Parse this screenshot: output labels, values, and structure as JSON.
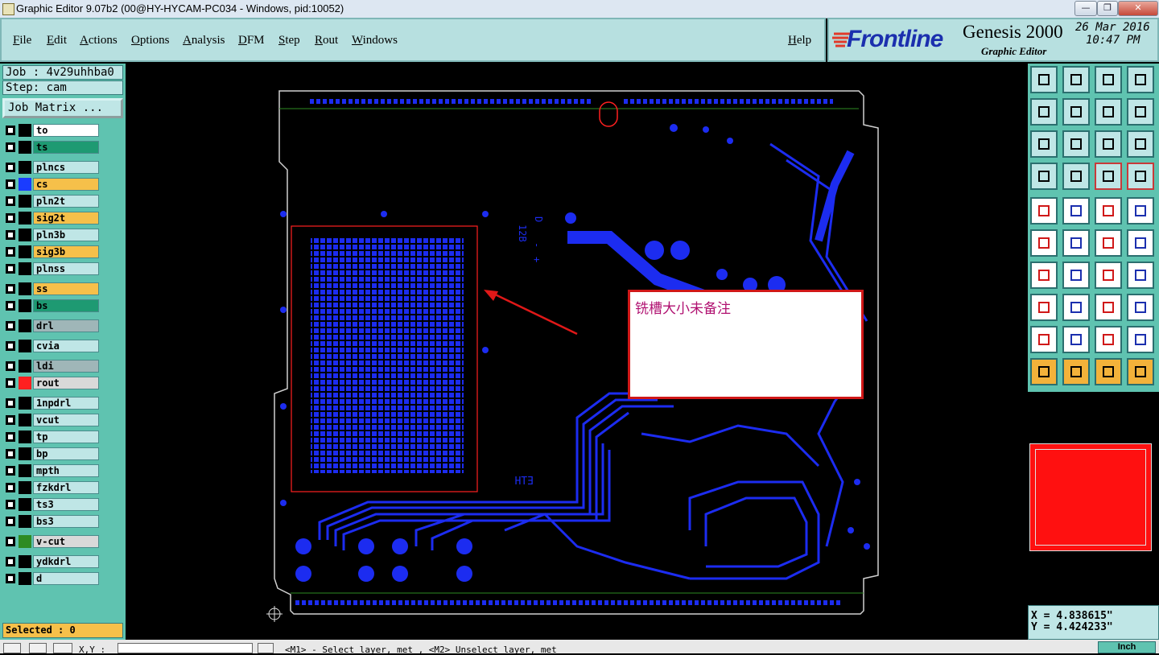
{
  "window": {
    "title": "Graphic Editor 9.07b2 (00@HY-HYCAM-PC034 - Windows, pid:10052)",
    "controls": [
      "—",
      "❐",
      "✕"
    ]
  },
  "menu": {
    "items": [
      "File",
      "Edit",
      "Actions",
      "Options",
      "Analysis",
      "DFM",
      "Step",
      "Rout",
      "Windows"
    ],
    "help": "Help"
  },
  "brand": {
    "logo": "Frontline",
    "product": "Genesis 2000",
    "subtitle": "Graphic Editor",
    "date": "26 Mar 2016",
    "time": "10:47 PM"
  },
  "job": {
    "job_label": "Job : 4v29uhhba0",
    "step_label": "Step: cam",
    "matrix_button": "Job Matrix ..."
  },
  "layers": [
    {
      "name": "to",
      "bg": "#ffffff",
      "swatch": "#000000"
    },
    {
      "name": "ts",
      "bg": "#1e9a72",
      "swatch": "#000000"
    },
    {
      "name": "plncs",
      "bg": "#bfe6e6",
      "swatch": "#000000"
    },
    {
      "name": "cs",
      "bg": "#f6c04a",
      "swatch": "#1a3cff"
    },
    {
      "name": "pln2t",
      "bg": "#bfe6e6",
      "swatch": "#000000"
    },
    {
      "name": "sig2t",
      "bg": "#f6c04a",
      "swatch": "#000000"
    },
    {
      "name": "pln3b",
      "bg": "#bfe6e6",
      "swatch": "#000000"
    },
    {
      "name": "sig3b",
      "bg": "#f6c04a",
      "swatch": "#000000"
    },
    {
      "name": "plnss",
      "bg": "#bfe6e6",
      "swatch": "#000000"
    },
    {
      "name": "ss",
      "bg": "#f6c04a",
      "swatch": "#000000"
    },
    {
      "name": "bs",
      "bg": "#1e9a72",
      "swatch": "#000000"
    },
    {
      "name": "drl",
      "bg": "#9fb6b8",
      "swatch": "#000000"
    },
    {
      "name": "cvia",
      "bg": "#bfe6e6",
      "swatch": "#000000"
    },
    {
      "name": "ldi",
      "bg": "#9fb6b8",
      "swatch": "#000000"
    },
    {
      "name": "rout",
      "bg": "#d9d9d9",
      "swatch": "#ff2020"
    },
    {
      "name": "1npdrl",
      "bg": "#bfe6e6",
      "swatch": "#000000"
    },
    {
      "name": "vcut",
      "bg": "#bfe6e6",
      "swatch": "#000000"
    },
    {
      "name": "tp",
      "bg": "#bfe6e6",
      "swatch": "#000000"
    },
    {
      "name": "bp",
      "bg": "#bfe6e6",
      "swatch": "#000000"
    },
    {
      "name": "mpth",
      "bg": "#bfe6e6",
      "swatch": "#000000"
    },
    {
      "name": "fzkdrl",
      "bg": "#bfe6e6",
      "swatch": "#000000"
    },
    {
      "name": "ts3",
      "bg": "#bfe6e6",
      "swatch": "#000000"
    },
    {
      "name": "bs3",
      "bg": "#bfe6e6",
      "swatch": "#000000"
    },
    {
      "name": "v-cut",
      "bg": "#d9d9d9",
      "swatch": "#2e8b22"
    },
    {
      "name": "ydkdrl",
      "bg": "#bfe6e6",
      "swatch": "#000000"
    },
    {
      "name": "d",
      "bg": "#bfe6e6",
      "swatch": "#000000"
    }
  ],
  "selected_label": "Selected : 0",
  "canvas": {
    "annotation": "铣槽大小未备注",
    "silk_labels": [
      "D",
      "-",
      "+",
      "ETH",
      "12B"
    ],
    "colors": {
      "trace": "#1c2cf0",
      "outline": "#ff2020",
      "board_edge": "#d0d0d0"
    }
  },
  "coords": {
    "x": "X = 4.838615\"",
    "y": "Y = 4.424233\""
  },
  "status": {
    "xy_label": "X,Y :",
    "message": "<M1> - Select layer, met , <M2> Unselect layer, met",
    "units": "Inch"
  }
}
